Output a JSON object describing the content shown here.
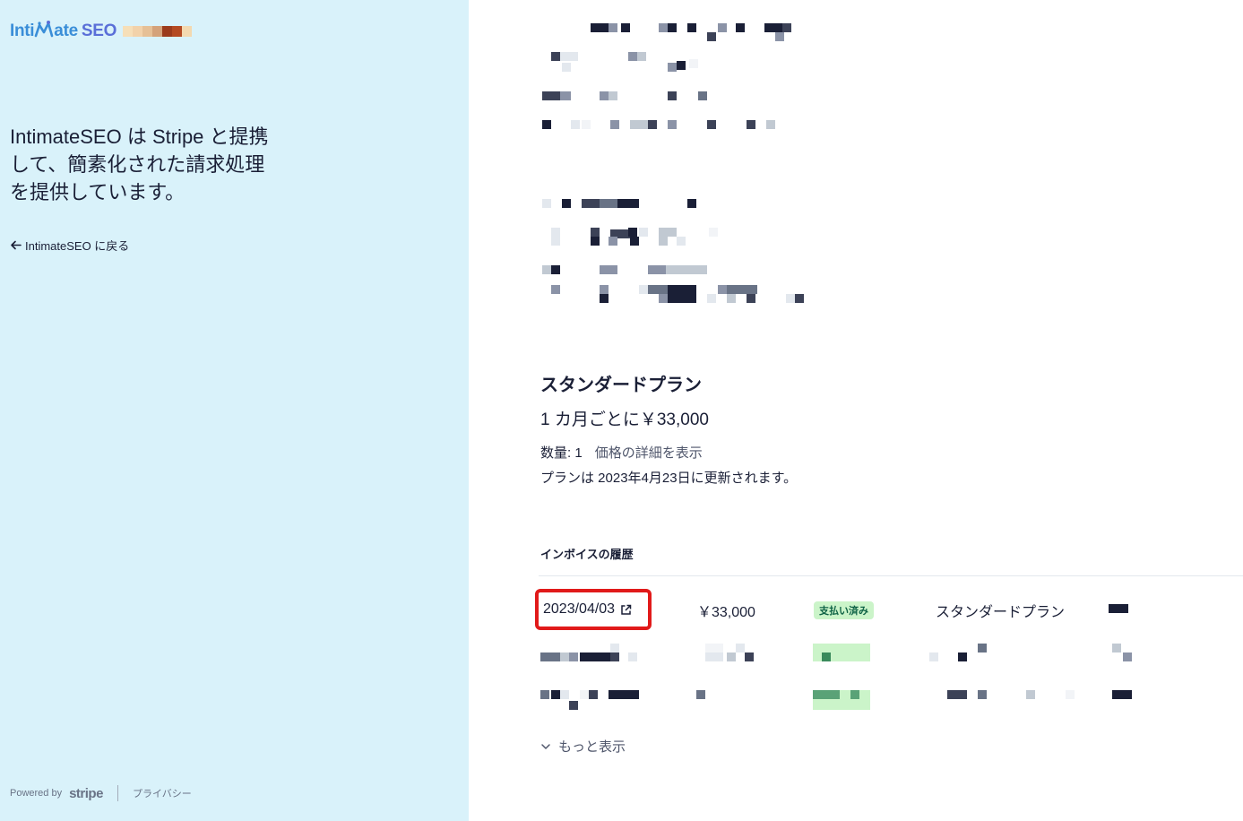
{
  "brand": {
    "name_part1": "Inti",
    "name_part2": "ate",
    "name_part3": "SEO",
    "colors": {
      "primary": "#3a8ed8",
      "secondary": "#5a6fd8"
    }
  },
  "sidebar": {
    "tagline": "IntimateSEO は Stripe と提携して、簡素化された請求処理を提供しています。",
    "back_link": "IntimateSEO に戻る",
    "footer": {
      "powered_by": "Powered by",
      "stripe": "stripe",
      "privacy": "プライバシー"
    }
  },
  "plan": {
    "title": "スタンダードプラン",
    "price": "1 カ月ごとに￥33,000",
    "quantity": "数量: 1",
    "price_detail_link": "価格の詳細を表示",
    "renewal": "プランは 2023年4月23日に更新されます。"
  },
  "invoice_history": {
    "title": "インボイスの履歴",
    "rows": [
      {
        "date": "2023/04/03",
        "amount": "￥33,000",
        "status": "支払い済み",
        "plan": "スタンダードプラン"
      }
    ],
    "more_link": "もっと表示"
  },
  "colors": {
    "left_bg": "#d9f2fa",
    "highlight_border": "#e11a1a",
    "paid_badge_bg": "#cbf4c9",
    "paid_badge_text": "#0e6245"
  }
}
